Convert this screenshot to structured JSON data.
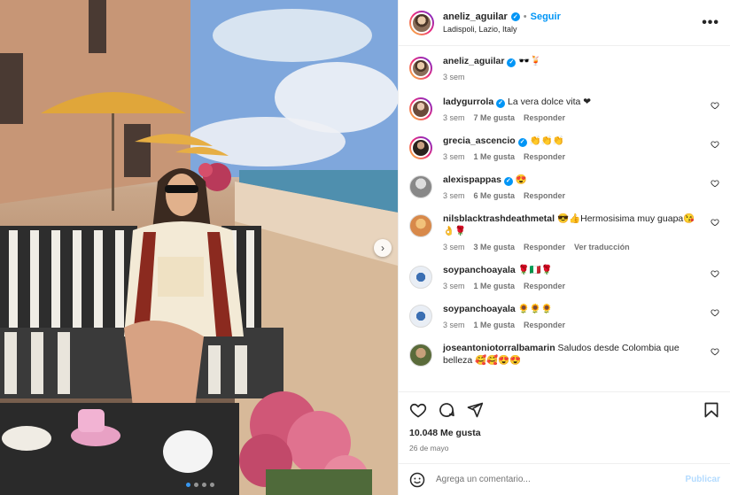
{
  "post": {
    "username": "aneliz_aguilar",
    "follow_label": "Seguir",
    "separator": "•",
    "location": "Ladispoli, Lazio, Italy",
    "more_label": "•••",
    "caption": "🕶️🍹",
    "caption_time": "3 sem",
    "likes": "10.048 Me gusta",
    "date": "26 de mayo",
    "carousel_next": "›"
  },
  "comments": [
    {
      "user": "ladygurrola",
      "verified": true,
      "text": "La vera dolce vita ❤",
      "time": "3 sem",
      "likes": "7 Me gusta",
      "reply": "Responder",
      "translate": ""
    },
    {
      "user": "grecia_ascencio",
      "verified": true,
      "text": "👏👏👏",
      "time": "3 sem",
      "likes": "1 Me gusta",
      "reply": "Responder",
      "translate": ""
    },
    {
      "user": "alexispappas",
      "verified": true,
      "text": "😍",
      "time": "3 sem",
      "likes": "6 Me gusta",
      "reply": "Responder",
      "translate": ""
    },
    {
      "user": "nilsblacktrashdeathmetal",
      "verified": false,
      "text": "😎👍Hermosisima muy guapa😘👌🌹",
      "time": "3 sem",
      "likes": "3 Me gusta",
      "reply": "Responder",
      "translate": "Ver traducción"
    },
    {
      "user": "soypanchoayala",
      "verified": false,
      "text": "🌹🇮🇹🌹",
      "time": "3 sem",
      "likes": "1 Me gusta",
      "reply": "Responder",
      "translate": ""
    },
    {
      "user": "soypanchoayala",
      "verified": false,
      "text": "🌻🌻🌻",
      "time": "3 sem",
      "likes": "1 Me gusta",
      "reply": "Responder",
      "translate": ""
    },
    {
      "user": "joseantoniotorralbamarin",
      "verified": false,
      "text": "Saludos desde Colombia que belleza 🥰🥰😍😍",
      "time": "",
      "likes": "",
      "reply": "",
      "translate": ""
    }
  ],
  "add_comment": {
    "placeholder": "Agrega un comentario...",
    "publish_label": "Publicar"
  },
  "colors": {
    "accent": "#0095f6",
    "publish_disabled": "#b3dbff",
    "muted": "#737373"
  },
  "icons": [
    "heart-icon",
    "comment-icon",
    "share-icon",
    "bookmark-icon",
    "emoji-icon",
    "verified-icon",
    "more-icon",
    "chevron-right-icon"
  ]
}
